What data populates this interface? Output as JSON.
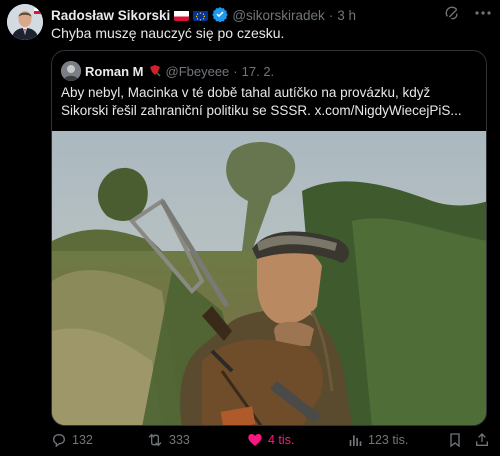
{
  "author": {
    "name": "Radosław Sikorski",
    "handle": "@sikorskiradek",
    "time": "3 h"
  },
  "post_text": "Chyba muszę nauczyć się po czesku.",
  "quoted": {
    "name": "Roman M",
    "handle": "@Fbeyeee",
    "date": "17. 2.",
    "text": "Aby nebyl, Macinka v té době tahal autíčko na provázku, když Sikorski řešil zahraniční politiku se SSSR.  x.com/NigdyWiecejPiS..."
  },
  "actions": {
    "replies": "132",
    "reposts": "333",
    "likes": "4 tis.",
    "views": "123 tis."
  },
  "colors": {
    "background": "#000000",
    "like_active": "#f91880",
    "verified": "#1d9bf0",
    "muted": "#71767b"
  },
  "icons": [
    "verified-badge-icon",
    "grok-icon",
    "more-icon",
    "reply-icon",
    "repost-icon",
    "heart-icon",
    "views-icon",
    "bookmark-icon",
    "share-icon"
  ]
}
